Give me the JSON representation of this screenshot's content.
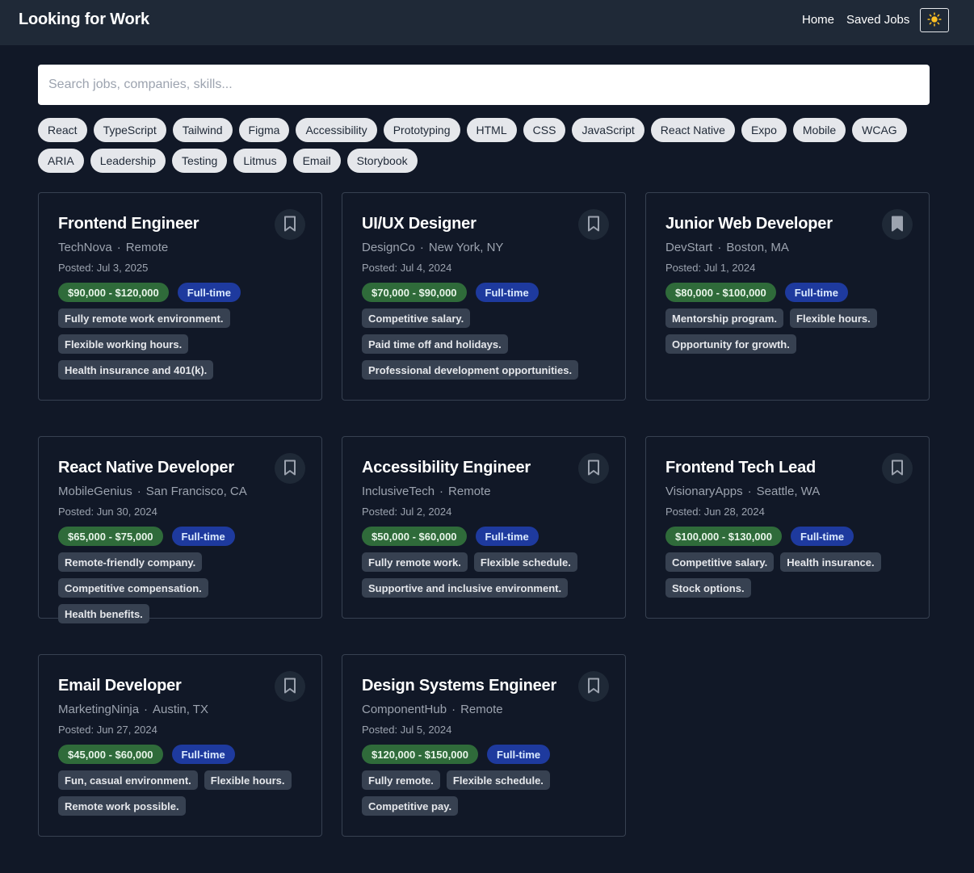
{
  "header": {
    "title": "Looking for Work",
    "nav": {
      "home": "Home",
      "saved": "Saved Jobs"
    },
    "theme_icon": "☀️"
  },
  "search": {
    "placeholder": "Search jobs, companies, skills...",
    "value": ""
  },
  "tags": [
    "React",
    "TypeScript",
    "Tailwind",
    "Figma",
    "Accessibility",
    "Prototyping",
    "HTML",
    "CSS",
    "JavaScript",
    "React Native",
    "Expo",
    "Mobile",
    "WCAG",
    "ARIA",
    "Leadership",
    "Testing",
    "Litmus",
    "Email",
    "Storybook"
  ],
  "jobs": [
    {
      "title": "Frontend Engineer",
      "company": "TechNova",
      "location": "Remote",
      "posted": "Posted: Jul 3, 2025",
      "salary": "$90,000 - $120,000",
      "type": "Full-time",
      "benefits": [
        "Fully remote work environment.",
        "Flexible working hours.",
        "Health insurance and 401(k)."
      ],
      "saved": false
    },
    {
      "title": "UI/UX Designer",
      "company": "DesignCo",
      "location": "New York, NY",
      "posted": "Posted: Jul 4, 2024",
      "salary": "$70,000 - $90,000",
      "type": "Full-time",
      "benefits": [
        "Competitive salary.",
        "Paid time off and holidays.",
        "Professional development opportunities."
      ],
      "saved": false
    },
    {
      "title": "Junior Web Developer",
      "company": "DevStart",
      "location": "Boston, MA",
      "posted": "Posted: Jul 1, 2024",
      "salary": "$80,000 - $100,000",
      "type": "Full-time",
      "benefits": [
        "Mentorship program.",
        "Flexible hours.",
        "Opportunity for growth."
      ],
      "saved": true
    },
    {
      "title": "React Native Developer",
      "company": "MobileGenius",
      "location": "San Francisco, CA",
      "posted": "Posted: Jun 30, 2024",
      "salary": "$65,000 - $75,000",
      "type": "Full-time",
      "benefits": [
        "Remote-friendly company.",
        "Competitive compensation.",
        "Health benefits."
      ],
      "saved": false
    },
    {
      "title": "Accessibility Engineer",
      "company": "InclusiveTech",
      "location": "Remote",
      "posted": "Posted: Jul 2, 2024",
      "salary": "$50,000 - $60,000",
      "type": "Full-time",
      "benefits": [
        "Fully remote work.",
        "Flexible schedule.",
        "Supportive and inclusive environment."
      ],
      "saved": false
    },
    {
      "title": "Frontend Tech Lead",
      "company": "VisionaryApps",
      "location": "Seattle, WA",
      "posted": "Posted: Jun 28, 2024",
      "salary": "$100,000 - $130,000",
      "type": "Full-time",
      "benefits": [
        "Competitive salary.",
        "Health insurance.",
        "Stock options."
      ],
      "saved": false
    },
    {
      "title": "Email Developer",
      "company": "MarketingNinja",
      "location": "Austin, TX",
      "posted": "Posted: Jun 27, 2024",
      "salary": "$45,000 - $60,000",
      "type": "Full-time",
      "benefits": [
        "Fun, casual environment.",
        "Flexible hours.",
        "Remote work possible."
      ],
      "saved": false
    },
    {
      "title": "Design Systems Engineer",
      "company": "ComponentHub",
      "location": "Remote",
      "posted": "Posted: Jul 5, 2024",
      "salary": "$120,000 - $150,000",
      "type": "Full-time",
      "benefits": [
        "Fully remote.",
        "Flexible schedule.",
        "Competitive pay."
      ],
      "saved": false
    }
  ],
  "colors": {
    "background": "#111827",
    "header": "#1f2937",
    "salary_badge": "#2f6b3a",
    "type_badge": "#1e3a9e",
    "benefit_chip": "#374151"
  },
  "icons": {
    "bookmark": "bookmark-icon",
    "theme": "sun-icon"
  }
}
